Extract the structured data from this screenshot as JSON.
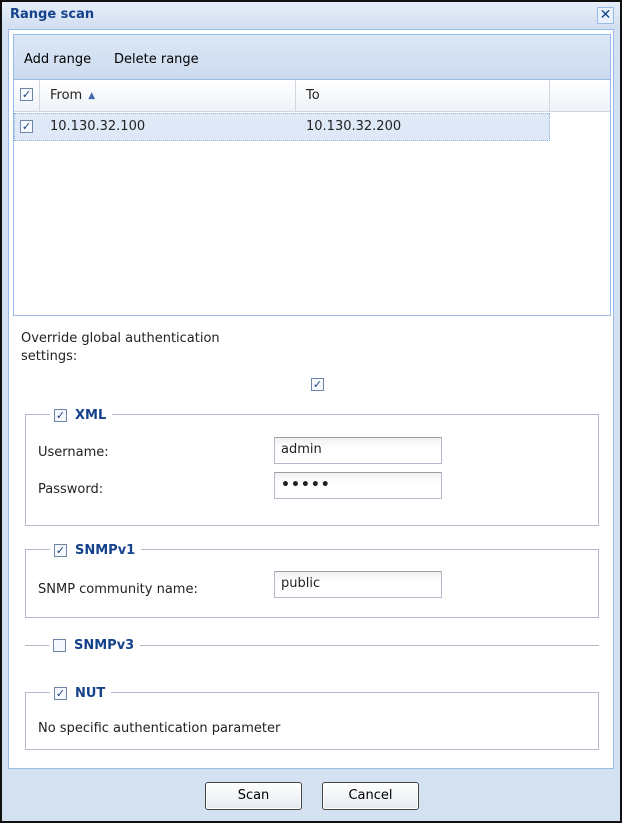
{
  "window": {
    "title": "Range scan",
    "close_symbol": "✕"
  },
  "toolbar": {
    "add_label": "Add range",
    "delete_label": "Delete range"
  },
  "grid": {
    "columns": [
      "From",
      "To"
    ],
    "sort_symbol": "▲",
    "rows": [
      {
        "checked": true,
        "from": "10.130.32.100",
        "to": "10.130.32.200"
      }
    ],
    "header_checked": true
  },
  "override": {
    "label": "Override global authentication settings:",
    "checked": true
  },
  "checkmark": "✓",
  "xml": {
    "legend": "XML",
    "checked": true,
    "username_label": "Username:",
    "username_value": "admin",
    "password_label": "Password:",
    "password_value": "•••••"
  },
  "snmpv1": {
    "legend": "SNMPv1",
    "checked": true,
    "community_label": "SNMP community name:",
    "community_value": "public"
  },
  "snmpv3": {
    "legend": "SNMPv3",
    "checked": false
  },
  "nut": {
    "legend": "NUT",
    "checked": true,
    "message": "No specific authentication parameter"
  },
  "buttons": {
    "scan": "Scan",
    "cancel": "Cancel"
  }
}
